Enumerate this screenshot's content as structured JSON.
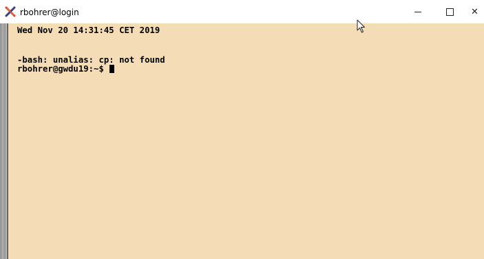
{
  "window": {
    "title": "rbohrer@login",
    "icon": "putty-x-icon",
    "controls": [
      "minimize-icon",
      "maximize-icon",
      "close-icon"
    ],
    "close_glyph": "✕"
  },
  "terminal": {
    "background": "#f3dcb6",
    "foreground": "#000000",
    "lines": [
      "Wed Nov 20 14:31:45 CET 2019",
      "-bash: unalias: cp: not found",
      "rbohrer@gwdu19:~$ "
    ]
  }
}
